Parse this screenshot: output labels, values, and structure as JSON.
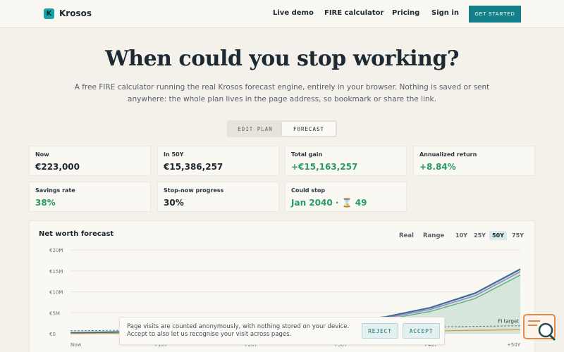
{
  "nav": {
    "brand": "Krosos",
    "logo_letter": "K",
    "links": [
      "Live demo",
      "FIRE calculator",
      "Pricing",
      "Sign in"
    ],
    "cta": "GET STARTED"
  },
  "hero": {
    "title": "When could you stop working?",
    "subtitle": "A free FIRE calculator running the real Krosos forecast engine, entirely in your browser. Nothing is saved or sent anywhere: the whole plan lives in the page address, so bookmark or share the link."
  },
  "toggle": {
    "edit": "EDIT PLAN",
    "forecast": "FORECAST",
    "active": "forecast"
  },
  "stats": [
    {
      "label": "Now",
      "value": "€223,000",
      "tone": "default"
    },
    {
      "label": "In 50Y",
      "value": "€15,386,257",
      "tone": "default"
    },
    {
      "label": "Total gain",
      "value": "+€15,163,257",
      "tone": "green"
    },
    {
      "label": "Annualized return",
      "value": "+8.84%",
      "tone": "green"
    },
    {
      "label": "Savings rate",
      "value": "38%",
      "tone": "green"
    },
    {
      "label": "Stop-now progress",
      "value": "30%",
      "tone": "default"
    },
    {
      "label": "Could stop",
      "value": "Jan 2040 · ⌛ 49",
      "tone": "green"
    }
  ],
  "chart": {
    "title": "Net worth forecast",
    "controls": [
      "Real",
      "Range"
    ],
    "ranges": [
      "10Y",
      "25Y",
      "50Y",
      "75Y"
    ],
    "active_range": "50Y"
  },
  "chart_data": {
    "type": "area",
    "title": "Net worth forecast",
    "ytick_labels": [
      "€0",
      "€5M",
      "€10M",
      "€15M",
      "€20M"
    ],
    "yticks": [
      0,
      5,
      10,
      15,
      20
    ],
    "ylim": [
      0,
      20
    ],
    "xtick_labels": [
      "Now",
      "+10Y",
      "+20Y",
      "+30Y",
      "+40Y",
      "+50Y"
    ],
    "x": [
      0,
      5,
      10,
      15,
      20,
      25,
      30,
      35,
      40,
      45,
      50
    ],
    "series": [
      {
        "values": [
          0.22,
          0.4,
          0.65,
          0.95,
          1.35,
          1.95,
          2.8,
          4.0,
          6.2,
          9.7,
          15.4
        ]
      },
      {
        "values": [
          0.22,
          0.38,
          0.6,
          0.88,
          1.25,
          1.8,
          2.6,
          3.7,
          5.8,
          9.1,
          14.8
        ]
      },
      {
        "values": [
          0.22,
          0.36,
          0.56,
          0.82,
          1.15,
          1.65,
          2.4,
          3.4,
          5.3,
          8.4,
          14.0
        ]
      }
    ],
    "reference_lines": [
      {
        "label": "FI target",
        "values": [
          0.7,
          0.8,
          0.9,
          1.0,
          1.1,
          1.2,
          1.3,
          1.45,
          1.6,
          1.75,
          1.9
        ]
      },
      {
        "values": [
          0.0,
          0.05,
          0.1,
          0.15,
          0.22,
          0.3,
          0.38,
          0.5,
          0.65,
          0.8,
          0.95
        ]
      }
    ],
    "colors": {
      "main": "#3b6f9a",
      "mid": "#9a86c2",
      "low": "#5fae8a",
      "fill": "#cfe3d6",
      "fi": "#4f7f86",
      "spend": "#d8a040"
    }
  },
  "cookie": {
    "text": "Page visits are counted anonymously, with nothing stored on your device. Accept to also let us recognise your visit across pages.",
    "reject": "REJECT",
    "accept": "ACCEPT"
  },
  "widget_icon": "chat-search-icon"
}
